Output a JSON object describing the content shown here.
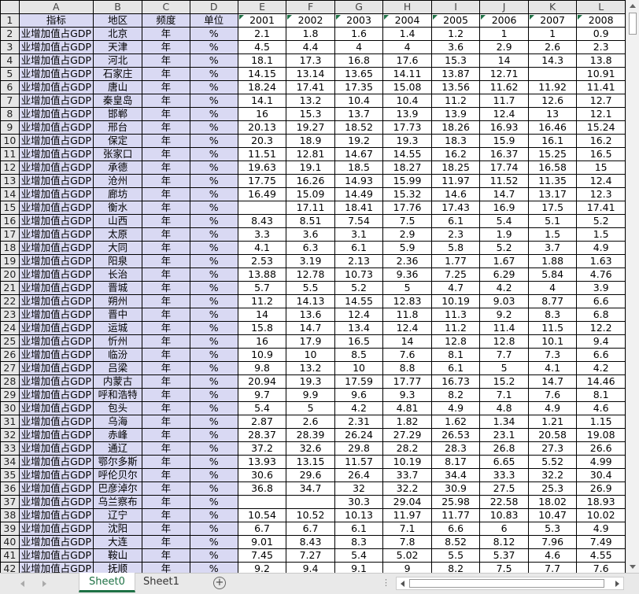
{
  "columns": [
    "A",
    "B",
    "C",
    "D",
    "E",
    "F",
    "G",
    "H",
    "I",
    "J",
    "K",
    "L"
  ],
  "header_row": {
    "row_num": "1",
    "cells": [
      "指标",
      "地区",
      "频度",
      "单位",
      "2001",
      "2002",
      "2003",
      "2004",
      "2005",
      "2006",
      "2007",
      "2008"
    ]
  },
  "rows": [
    {
      "num": "2",
      "cells": [
        "业增加值占GDP",
        "北京",
        "年",
        "%",
        "2.1",
        "1.8",
        "1.6",
        "1.4",
        "1.2",
        "1",
        "1",
        "0.9"
      ]
    },
    {
      "num": "3",
      "cells": [
        "业增加值占GDP",
        "天津",
        "年",
        "%",
        "4.5",
        "4.4",
        "4",
        "4",
        "3.6",
        "2.9",
        "2.6",
        "2.3"
      ]
    },
    {
      "num": "4",
      "cells": [
        "业增加值占GDP",
        "河北",
        "年",
        "%",
        "18.1",
        "17.3",
        "16.8",
        "17.6",
        "15.3",
        "14",
        "14.3",
        "13.8"
      ]
    },
    {
      "num": "5",
      "cells": [
        "业增加值占GDP",
        "石家庄",
        "年",
        "%",
        "14.15",
        "13.14",
        "13.65",
        "14.11",
        "13.87",
        "12.71",
        "",
        "10.91"
      ]
    },
    {
      "num": "6",
      "cells": [
        "业增加值占GDP",
        "唐山",
        "年",
        "%",
        "18.24",
        "17.41",
        "17.35",
        "15.08",
        "13.56",
        "11.62",
        "11.92",
        "11.41"
      ]
    },
    {
      "num": "7",
      "cells": [
        "业增加值占GDP",
        "秦皇岛",
        "年",
        "%",
        "14.1",
        "13.2",
        "10.4",
        "10.4",
        "11.2",
        "11.7",
        "12.6",
        "12.7"
      ]
    },
    {
      "num": "8",
      "cells": [
        "业增加值占GDP",
        "邯郸",
        "年",
        "%",
        "16",
        "15.3",
        "13.7",
        "13.9",
        "13.9",
        "12.4",
        "13",
        "12.1"
      ]
    },
    {
      "num": "9",
      "cells": [
        "业增加值占GDP",
        "邢台",
        "年",
        "%",
        "20.13",
        "19.27",
        "18.52",
        "17.73",
        "18.26",
        "16.93",
        "16.46",
        "15.24"
      ]
    },
    {
      "num": "10",
      "cells": [
        "业增加值占GDP",
        "保定",
        "年",
        "%",
        "20.3",
        "18.9",
        "19.2",
        "19.3",
        "18.3",
        "15.9",
        "16.1",
        "16.2"
      ]
    },
    {
      "num": "11",
      "cells": [
        "业增加值占GDP",
        "张家口",
        "年",
        "%",
        "11.51",
        "12.81",
        "14.67",
        "14.55",
        "16.2",
        "16.37",
        "15.25",
        "16.5"
      ]
    },
    {
      "num": "12",
      "cells": [
        "业增加值占GDP",
        "承德",
        "年",
        "%",
        "19.63",
        "19.1",
        "18.5",
        "18.27",
        "18.25",
        "17.74",
        "16.58",
        "15"
      ]
    },
    {
      "num": "13",
      "cells": [
        "业增加值占GDP",
        "沧州",
        "年",
        "%",
        "17.75",
        "16.26",
        "14.93",
        "15.99",
        "11.97",
        "11.52",
        "11.35",
        "12.4"
      ]
    },
    {
      "num": "14",
      "cells": [
        "业增加值占GDP",
        "廊坊",
        "年",
        "%",
        "16.49",
        "15.09",
        "14.49",
        "15.32",
        "14.6",
        "14.7",
        "13.17",
        "12.3"
      ]
    },
    {
      "num": "15",
      "cells": [
        "业增加值占GDP",
        "衡水",
        "年",
        "%",
        "",
        "17.11",
        "18.41",
        "17.76",
        "17.43",
        "16.9",
        "17.5",
        "17.41"
      ]
    },
    {
      "num": "16",
      "cells": [
        "业增加值占GDP",
        "山西",
        "年",
        "%",
        "8.43",
        "8.51",
        "7.54",
        "7.5",
        "6.1",
        "5.4",
        "5.1",
        "5.2"
      ]
    },
    {
      "num": "17",
      "cells": [
        "业增加值占GDP",
        "太原",
        "年",
        "%",
        "3.3",
        "3.6",
        "3.1",
        "2.9",
        "2.3",
        "1.9",
        "1.5",
        "1.5"
      ]
    },
    {
      "num": "18",
      "cells": [
        "业增加值占GDP",
        "大同",
        "年",
        "%",
        "4.1",
        "6.3",
        "6.1",
        "5.9",
        "5.8",
        "5.2",
        "3.7",
        "4.9"
      ]
    },
    {
      "num": "19",
      "cells": [
        "业增加值占GDP",
        "阳泉",
        "年",
        "%",
        "2.53",
        "3.19",
        "2.13",
        "2.36",
        "1.77",
        "1.67",
        "1.88",
        "1.63"
      ]
    },
    {
      "num": "20",
      "cells": [
        "业增加值占GDP",
        "长治",
        "年",
        "%",
        "13.88",
        "12.78",
        "10.73",
        "9.36",
        "7.25",
        "6.29",
        "5.84",
        "4.76"
      ]
    },
    {
      "num": "21",
      "cells": [
        "业增加值占GDP",
        "晋城",
        "年",
        "%",
        "5.7",
        "5.5",
        "5.2",
        "5",
        "4.7",
        "4.2",
        "4",
        "3.9"
      ]
    },
    {
      "num": "22",
      "cells": [
        "业增加值占GDP",
        "朔州",
        "年",
        "%",
        "11.2",
        "14.13",
        "14.55",
        "12.83",
        "10.19",
        "9.03",
        "8.77",
        "6.6"
      ]
    },
    {
      "num": "23",
      "cells": [
        "业增加值占GDP",
        "晋中",
        "年",
        "%",
        "14",
        "13.6",
        "12.4",
        "11.8",
        "11.3",
        "9.2",
        "8.3",
        "6.8"
      ]
    },
    {
      "num": "24",
      "cells": [
        "业增加值占GDP",
        "运城",
        "年",
        "%",
        "15.8",
        "14.7",
        "13.4",
        "12.4",
        "11.2",
        "11.4",
        "11.5",
        "12.2"
      ]
    },
    {
      "num": "25",
      "cells": [
        "业增加值占GDP",
        "忻州",
        "年",
        "%",
        "16",
        "17.9",
        "16.5",
        "14",
        "12.8",
        "12.8",
        "10.1",
        "9.4"
      ]
    },
    {
      "num": "26",
      "cells": [
        "业增加值占GDP",
        "临汾",
        "年",
        "%",
        "10.9",
        "10",
        "8.5",
        "7.6",
        "8.1",
        "7.7",
        "7.3",
        "6.6"
      ]
    },
    {
      "num": "27",
      "cells": [
        "业增加值占GDP",
        "吕梁",
        "年",
        "%",
        "9.8",
        "13.2",
        "10",
        "8.8",
        "6.1",
        "5",
        "4.1",
        "4.2"
      ]
    },
    {
      "num": "28",
      "cells": [
        "业增加值占GDP",
        "内蒙古",
        "年",
        "%",
        "20.94",
        "19.3",
        "17.59",
        "17.77",
        "16.73",
        "15.2",
        "14.7",
        "14.46"
      ]
    },
    {
      "num": "29",
      "cells": [
        "业增加值占GDP",
        "呼和浩特",
        "年",
        "%",
        "9.7",
        "9.9",
        "9.6",
        "9.3",
        "8.2",
        "7.1",
        "7.6",
        "8.1"
      ]
    },
    {
      "num": "30",
      "cells": [
        "业增加值占GDP",
        "包头",
        "年",
        "%",
        "5.4",
        "5",
        "4.2",
        "4.81",
        "4.9",
        "4.8",
        "4.9",
        "4.6"
      ]
    },
    {
      "num": "31",
      "cells": [
        "业增加值占GDP",
        "乌海",
        "年",
        "%",
        "2.87",
        "2.6",
        "2.31",
        "1.82",
        "1.62",
        "1.34",
        "1.21",
        "1.15"
      ]
    },
    {
      "num": "32",
      "cells": [
        "业增加值占GDP",
        "赤峰",
        "年",
        "%",
        "28.37",
        "28.39",
        "26.24",
        "27.29",
        "26.53",
        "23.1",
        "20.58",
        "19.08"
      ]
    },
    {
      "num": "33",
      "cells": [
        "业增加值占GDP",
        "通辽",
        "年",
        "%",
        "37.2",
        "32.6",
        "29.8",
        "28.2",
        "28.3",
        "26.8",
        "27.3",
        "26.6"
      ]
    },
    {
      "num": "34",
      "cells": [
        "业增加值占GDP",
        "鄂尔多斯",
        "年",
        "%",
        "13.93",
        "13.15",
        "11.57",
        "10.19",
        "8.17",
        "6.65",
        "5.52",
        "4.99"
      ]
    },
    {
      "num": "35",
      "cells": [
        "业增加值占GDP",
        "呼伦贝尔",
        "年",
        "%",
        "30.6",
        "29.6",
        "26.4",
        "33.7",
        "34.4",
        "33.3",
        "32.2",
        "30.4"
      ]
    },
    {
      "num": "36",
      "cells": [
        "业增加值占GDP",
        "巴彦淖尔",
        "年",
        "%",
        "36.8",
        "34.7",
        "32",
        "32.2",
        "30.9",
        "27.5",
        "25.3",
        "26.9"
      ]
    },
    {
      "num": "37",
      "cells": [
        "业增加值占GDP",
        "乌兰察布",
        "年",
        "%",
        "",
        "",
        "30.3",
        "29.04",
        "25.98",
        "22.58",
        "18.02",
        "18.93"
      ]
    },
    {
      "num": "38",
      "cells": [
        "业增加值占GDP",
        "辽宁",
        "年",
        "%",
        "10.54",
        "10.52",
        "10.13",
        "11.97",
        "11.77",
        "10.83",
        "10.47",
        "10.02"
      ]
    },
    {
      "num": "39",
      "cells": [
        "业增加值占GDP",
        "沈阳",
        "年",
        "%",
        "6.7",
        "6.7",
        "6.1",
        "7.1",
        "6.6",
        "6",
        "5.3",
        "4.9"
      ]
    },
    {
      "num": "40",
      "cells": [
        "业增加值占GDP",
        "大连",
        "年",
        "%",
        "9.01",
        "8.43",
        "8.3",
        "7.8",
        "8.52",
        "8.12",
        "7.96",
        "7.49"
      ]
    },
    {
      "num": "41",
      "cells": [
        "业增加值占GDP",
        "鞍山",
        "年",
        "%",
        "7.45",
        "7.27",
        "5.4",
        "5.02",
        "5.5",
        "5.37",
        "4.6",
        "4.55"
      ]
    },
    {
      "num": "42",
      "cells": [
        "业增加值占GDP",
        "抚顺",
        "年",
        "%",
        "9.2",
        "9.4",
        "9.1",
        "9",
        "8.2",
        "7.5",
        "7.7",
        "7.6"
      ]
    }
  ],
  "sheets": [
    "Sheet0",
    "Sheet1"
  ],
  "add_sheet_symbol": "+",
  "separator_dots": "⋮",
  "colors": {
    "accent": "#1e7145",
    "highlight_columns": "#d9d9f3",
    "header_bg": "#e6e6e6"
  }
}
